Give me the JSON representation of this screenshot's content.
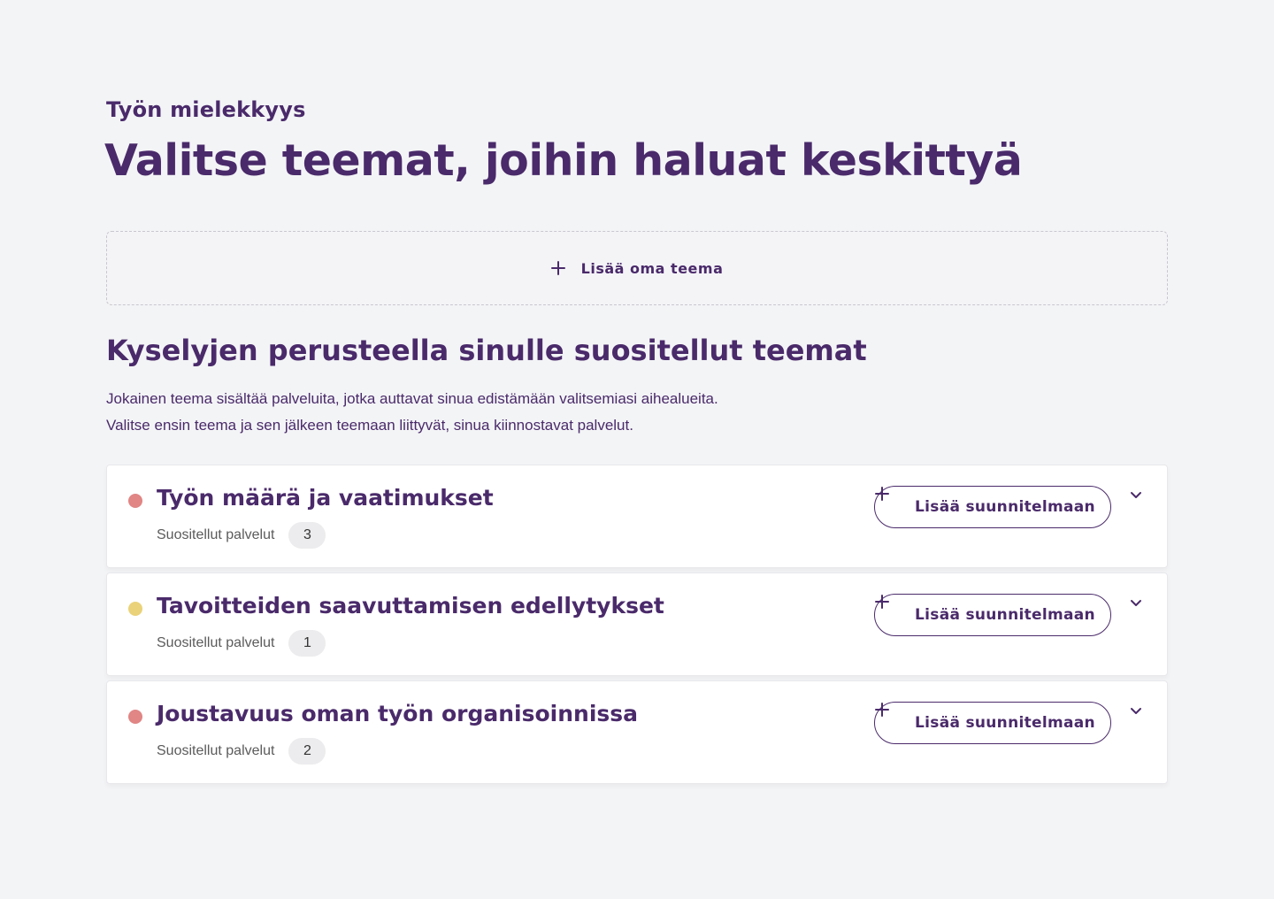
{
  "header": {
    "eyebrow": "Työn mielekkyys",
    "title": "Valitse teemat, joihin haluat keskittyä"
  },
  "add_theme": {
    "label": "Lisää oma teema",
    "icon": "plus-icon"
  },
  "recommended": {
    "title": "Kyselyjen perusteella sinulle suositellut teemat",
    "description_line1": "Jokainen teema sisältää palveluita, jotka auttavat sinua edistämään valitsemiasi aihealueita.",
    "description_line2": "Valitse ensin teema ja sen jälkeen teemaan liittyvät, sinua kiinnostavat palvelut."
  },
  "themes": [
    {
      "name": "Työn määrä ja vaatimukset",
      "dot_color": "#e18585",
      "services_label": "Suositellut palvelut",
      "services_count": "3",
      "button_label": "Lisää suunnitelmaan"
    },
    {
      "name": "Tavoitteiden saavuttamisen edellytykset",
      "dot_color": "#ead27a",
      "services_label": "Suositellut palvelut",
      "services_count": "1",
      "button_label": "Lisää suunnitelmaan"
    },
    {
      "name": "Joustavuus oman työn organisoinnissa",
      "dot_color": "#e18585",
      "services_label": "Suositellut palvelut",
      "services_count": "2",
      "button_label": "Lisää suunnitelmaan"
    }
  ],
  "colors": {
    "primary": "#4a2a6a",
    "background": "#f3f4f6"
  }
}
